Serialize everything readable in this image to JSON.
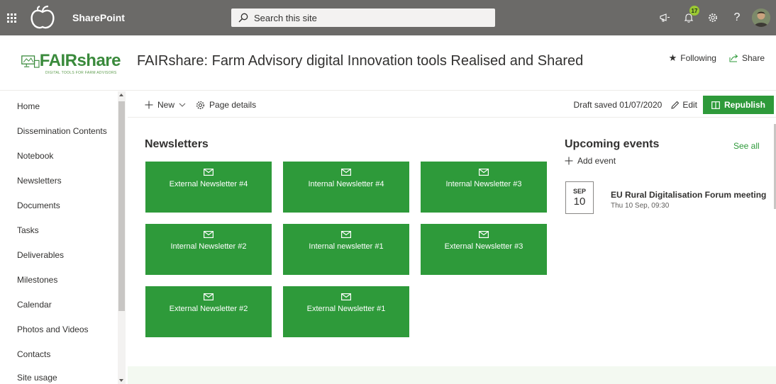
{
  "suite_bar": {
    "app_name": "SharePoint",
    "search_placeholder": "Search this site",
    "notification_count": "17",
    "help_label": "?"
  },
  "site": {
    "logo": {
      "primary": "FAIR",
      "secondary": "share",
      "tagline": "DIGITAL TOOLS FOR FARM ADVISORS"
    },
    "title": "FAIRshare: Farm Advisory digital Innovation tools Realised and Shared",
    "following_label": "Following",
    "share_label": "Share"
  },
  "left_nav": {
    "items": [
      {
        "label": "Home"
      },
      {
        "label": "Dissemination Contents"
      },
      {
        "label": "Notebook"
      },
      {
        "label": "Newsletters"
      },
      {
        "label": "Documents"
      },
      {
        "label": "Tasks"
      },
      {
        "label": "Deliverables"
      },
      {
        "label": "Milestones"
      },
      {
        "label": "Calendar"
      },
      {
        "label": "Photos and Videos"
      },
      {
        "label": "Contacts"
      },
      {
        "label": "Site usage"
      }
    ]
  },
  "command_bar": {
    "new_label": "New",
    "page_details_label": "Page details",
    "draft_status": "Draft saved 01/07/2020",
    "edit_label": "Edit",
    "republish_label": "Republish"
  },
  "newsletters": {
    "title": "Newsletters",
    "tiles": [
      {
        "label": "External Newsletter #4"
      },
      {
        "label": "Internal Newsletter #4"
      },
      {
        "label": "Internal Newsletter #3"
      },
      {
        "label": "Internal Newsletter #2"
      },
      {
        "label": "Internal newsletter #1"
      },
      {
        "label": "External Newsletter #3"
      },
      {
        "label": "External Newsletter #2"
      },
      {
        "label": "External Newsletter #1"
      }
    ]
  },
  "events": {
    "title": "Upcoming events",
    "see_all_label": "See all",
    "add_event_label": "Add event",
    "items": [
      {
        "month": "SEP",
        "day": "10",
        "title": "EU Rural Digitalisation Forum meeting",
        "time": "Thu 10 Sep, 09:30"
      }
    ]
  },
  "colors": {
    "suite_bar": "#6b6a68",
    "accent_green": "#2e9a3a",
    "badge": "#9bc832"
  }
}
